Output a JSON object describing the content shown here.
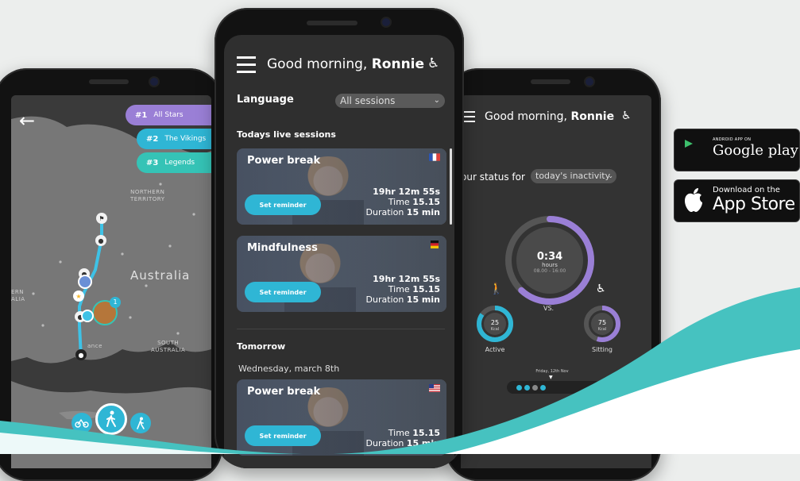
{
  "map_app": {
    "leaderboard": [
      {
        "rank": "#1",
        "name": "All Stars",
        "color": "#9a7fd6"
      },
      {
        "rank": "#2",
        "name": "The Vikings",
        "color": "#2fb6d5"
      },
      {
        "rank": "#3",
        "name": "Legends",
        "color": "#35c3b6"
      }
    ],
    "labels": {
      "northern_territory": "NORTHERN\nTERRITORY",
      "australia": "Australia",
      "south_australia": "SOUTH\nAUSTRALIA",
      "western_australia_partial": "ERN\nALIA",
      "place": "ance"
    },
    "marker_count": "1",
    "active_mode": "Walk",
    "colors": {
      "accent": "#2fb6d5",
      "route": "#3ec2e6"
    }
  },
  "sessions_app": {
    "greeting": "Good morning, ",
    "user_name": "Ronnie",
    "language_label": "Language",
    "filter_value": "All sessions",
    "today_heading": "Todays live sessions",
    "tomorrow_heading": "Tomorrow",
    "tomorrow_date": "Wednesday, march 8th",
    "reminder_label": "Set reminder",
    "sessions": [
      {
        "title": "Power break",
        "countdown": "19hr 12m 55s",
        "time_label": "Time",
        "time": "15.15",
        "duration_label": "Duration",
        "duration": "15 min",
        "flag": "france"
      },
      {
        "title": "Mindfulness",
        "countdown": "19hr 12m 55s",
        "time_label": "Time",
        "time": "15.15",
        "duration_label": "Duration",
        "duration": "15 min",
        "flag": "germany"
      },
      {
        "title": "Power break",
        "countdown": "",
        "time_label": "Time",
        "time": "15.15",
        "duration_label": "Duration",
        "duration": "15 min",
        "flag": "usa"
      }
    ]
  },
  "status_app": {
    "greeting": "Good morning, ",
    "user_name": "Ronnie",
    "status_prefix": "our status for",
    "status_filter": "today's inactivity",
    "big_value": "0:34",
    "big_unit": "hours",
    "big_range": "08.00 - 16:00",
    "progress_fraction": 0.62,
    "vs_label": "VS.",
    "active": {
      "value": "25",
      "unit": "Kcal",
      "label": "Active",
      "fraction": 0.85
    },
    "sitting": {
      "value": "75",
      "unit": "Kcal",
      "label": "Sitting",
      "fraction": 0.55
    },
    "date_label": "Friday, 12th Nov"
  },
  "stores": {
    "google_small": "ANDROID APP ON",
    "google_big": "Google play",
    "apple_small": "Download on the",
    "apple_big": "App Store"
  }
}
